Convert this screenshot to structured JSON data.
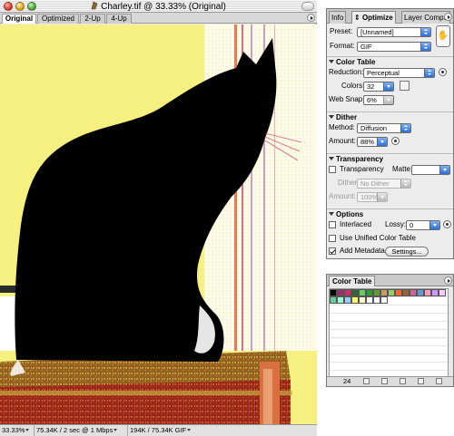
{
  "window": {
    "title": "Charley.tif @ 33.33% (Original)"
  },
  "doc_tabs": [
    "Original",
    "Optimized",
    "2-Up",
    "4-Up"
  ],
  "status": {
    "zoom": "33.33%",
    "download": "75.34K / 2 sec @ 1 Mbps",
    "size": "194K / 75.34K GIF"
  },
  "panel": {
    "tabs": [
      "Info",
      "Optimize",
      "Layer Comps"
    ],
    "preset_label": "Preset:",
    "preset_value": "[Unnamed]",
    "format_label": "Format:",
    "format_value": "GIF",
    "color_table": {
      "header": "Color Table",
      "reduction_label": "Reduction:",
      "reduction_value": "Perceptual",
      "colors_label": "Colors:",
      "colors_value": "32",
      "websnap_label": "Web Snap:",
      "websnap_value": "6%"
    },
    "dither": {
      "header": "Dither",
      "method_label": "Method:",
      "method_value": "Diffusion",
      "amount_label": "Amount:",
      "amount_value": "88%"
    },
    "transparency": {
      "header": "Transparency",
      "transparency_label": "Transparency",
      "transparency_checked": false,
      "matte_label": "Matte:",
      "dither_label": "Dither:",
      "dither_value": "No Dither",
      "amount_label": "Amount:",
      "amount_value": "100%"
    },
    "options": {
      "header": "Options",
      "interlaced_label": "Interlaced",
      "interlaced_checked": false,
      "lossy_label": "Lossy:",
      "lossy_value": "0",
      "unified_label": "Use Unified Color Table",
      "unified_checked": false,
      "metadata_label": "Add Metadata",
      "metadata_checked": true,
      "settings_button": "Settings..."
    }
  },
  "color_table_panel": {
    "tab": "Color Table",
    "count": "24",
    "swatch_colors": [
      "#000000",
      "#993366",
      "#cc3366",
      "#336633",
      "#66cc66",
      "#339933",
      "#669933",
      "#cc9966",
      "#99cc66",
      "#ff6633",
      "#996633",
      "#cc6699",
      "#6699cc",
      "#ff99cc",
      "#cc99ff",
      "#ffccff",
      "#66cc99",
      "#99ffcc",
      "#99ccff",
      "#ffff66",
      "#ffffcc",
      "#ffffff",
      "#ffffff",
      "#ffffff"
    ]
  }
}
